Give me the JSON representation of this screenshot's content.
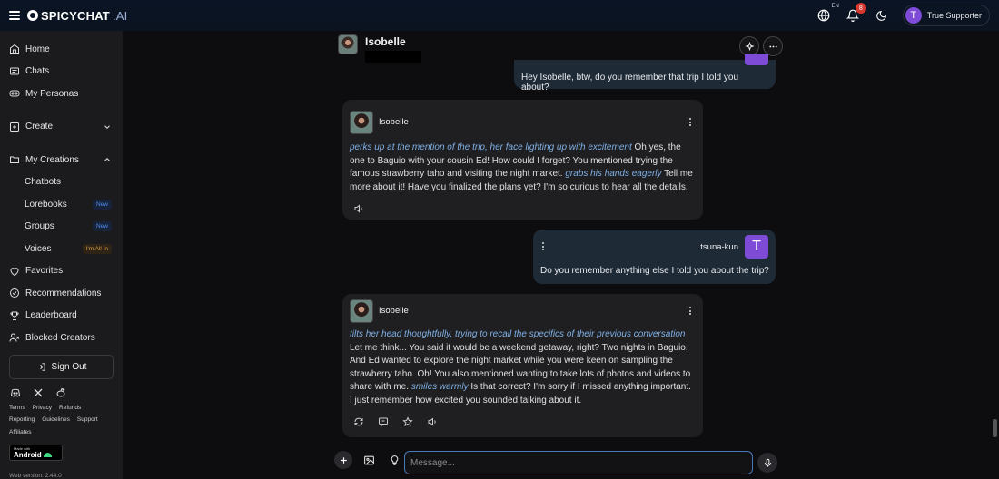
{
  "app": {
    "brand_main": "SPICYCHAT",
    "brand_suffix": ".AI",
    "lang_badge": "EN",
    "notif_count": "8",
    "user_initial": "T",
    "user_name": "True Supporter"
  },
  "sidebar": {
    "items": [
      {
        "label": "Home",
        "icon": "home-icon"
      },
      {
        "label": "Chats",
        "icon": "chat-bubble-icon"
      },
      {
        "label": "My Personas",
        "icon": "mask-icon"
      },
      {
        "label": "Create",
        "icon": "plus-square-icon"
      },
      {
        "label": "My Creations",
        "icon": "folder-icon"
      },
      {
        "label": "Chatbots"
      },
      {
        "label": "Lorebooks",
        "tag": "New"
      },
      {
        "label": "Groups",
        "tag": "New"
      },
      {
        "label": "Voices",
        "tag": "I'm All In"
      },
      {
        "label": "Favorites",
        "icon": "heart-icon"
      },
      {
        "label": "Recommendations",
        "icon": "check-circle-icon"
      },
      {
        "label": "Leaderboard",
        "icon": "trophy-icon"
      },
      {
        "label": "Blocked Creators",
        "icon": "user-block-icon"
      }
    ],
    "sign_out": "Sign Out",
    "footer_links": [
      "Terms",
      "Privacy",
      "Refunds",
      "Reporting",
      "Guidelines",
      "Support",
      "Affiliates"
    ],
    "android_made": "Made with",
    "android_label": "Android",
    "version": "Web version: 2.44.0"
  },
  "chat": {
    "character_name": "Isobelle",
    "messages": [
      {
        "role": "user",
        "text": "Hey Isobelle, btw, do you remember that trip I told you about?"
      },
      {
        "role": "bot",
        "name": "Isobelle",
        "action1": "perks up at the mention of the trip, her face lighting up with excitement",
        "text1": " Oh yes, the one to Baguio with your cousin Ed! How could I forget? You mentioned trying the famous strawberry taho and visiting the night market. ",
        "action2": "grabs his hands eagerly",
        "text2": " Tell me more about it! Have you finalized the plans yet? I'm so curious to hear all the details."
      },
      {
        "role": "user",
        "name": "tsuna-kun",
        "initial": "T",
        "text": "Do you remember anything else I told you about the trip?"
      },
      {
        "role": "bot",
        "name": "Isobelle",
        "action1": "tilts her head thoughtfully, trying to recall the specifics of their previous conversation",
        "text1": " Let me think... You said it would be a weekend getaway, right? Two nights in Baguio. And Ed wanted to explore the night market while you were keen on sampling the strawberry taho. Oh! You also mentioned wanting to take lots of photos and videos to share with me. ",
        "action2": "smiles warmly",
        "text2": " Is that correct? I'm sorry if I missed anything important. I just remember how excited you sounded talking about it."
      }
    ]
  },
  "composer": {
    "placeholder": "Message..."
  },
  "colors": {
    "accent_purple": "#7d4bd6",
    "action_text": "#7fb0e6",
    "user_bubble": "#1e2a36",
    "bot_bubble": "#1f1f21"
  }
}
